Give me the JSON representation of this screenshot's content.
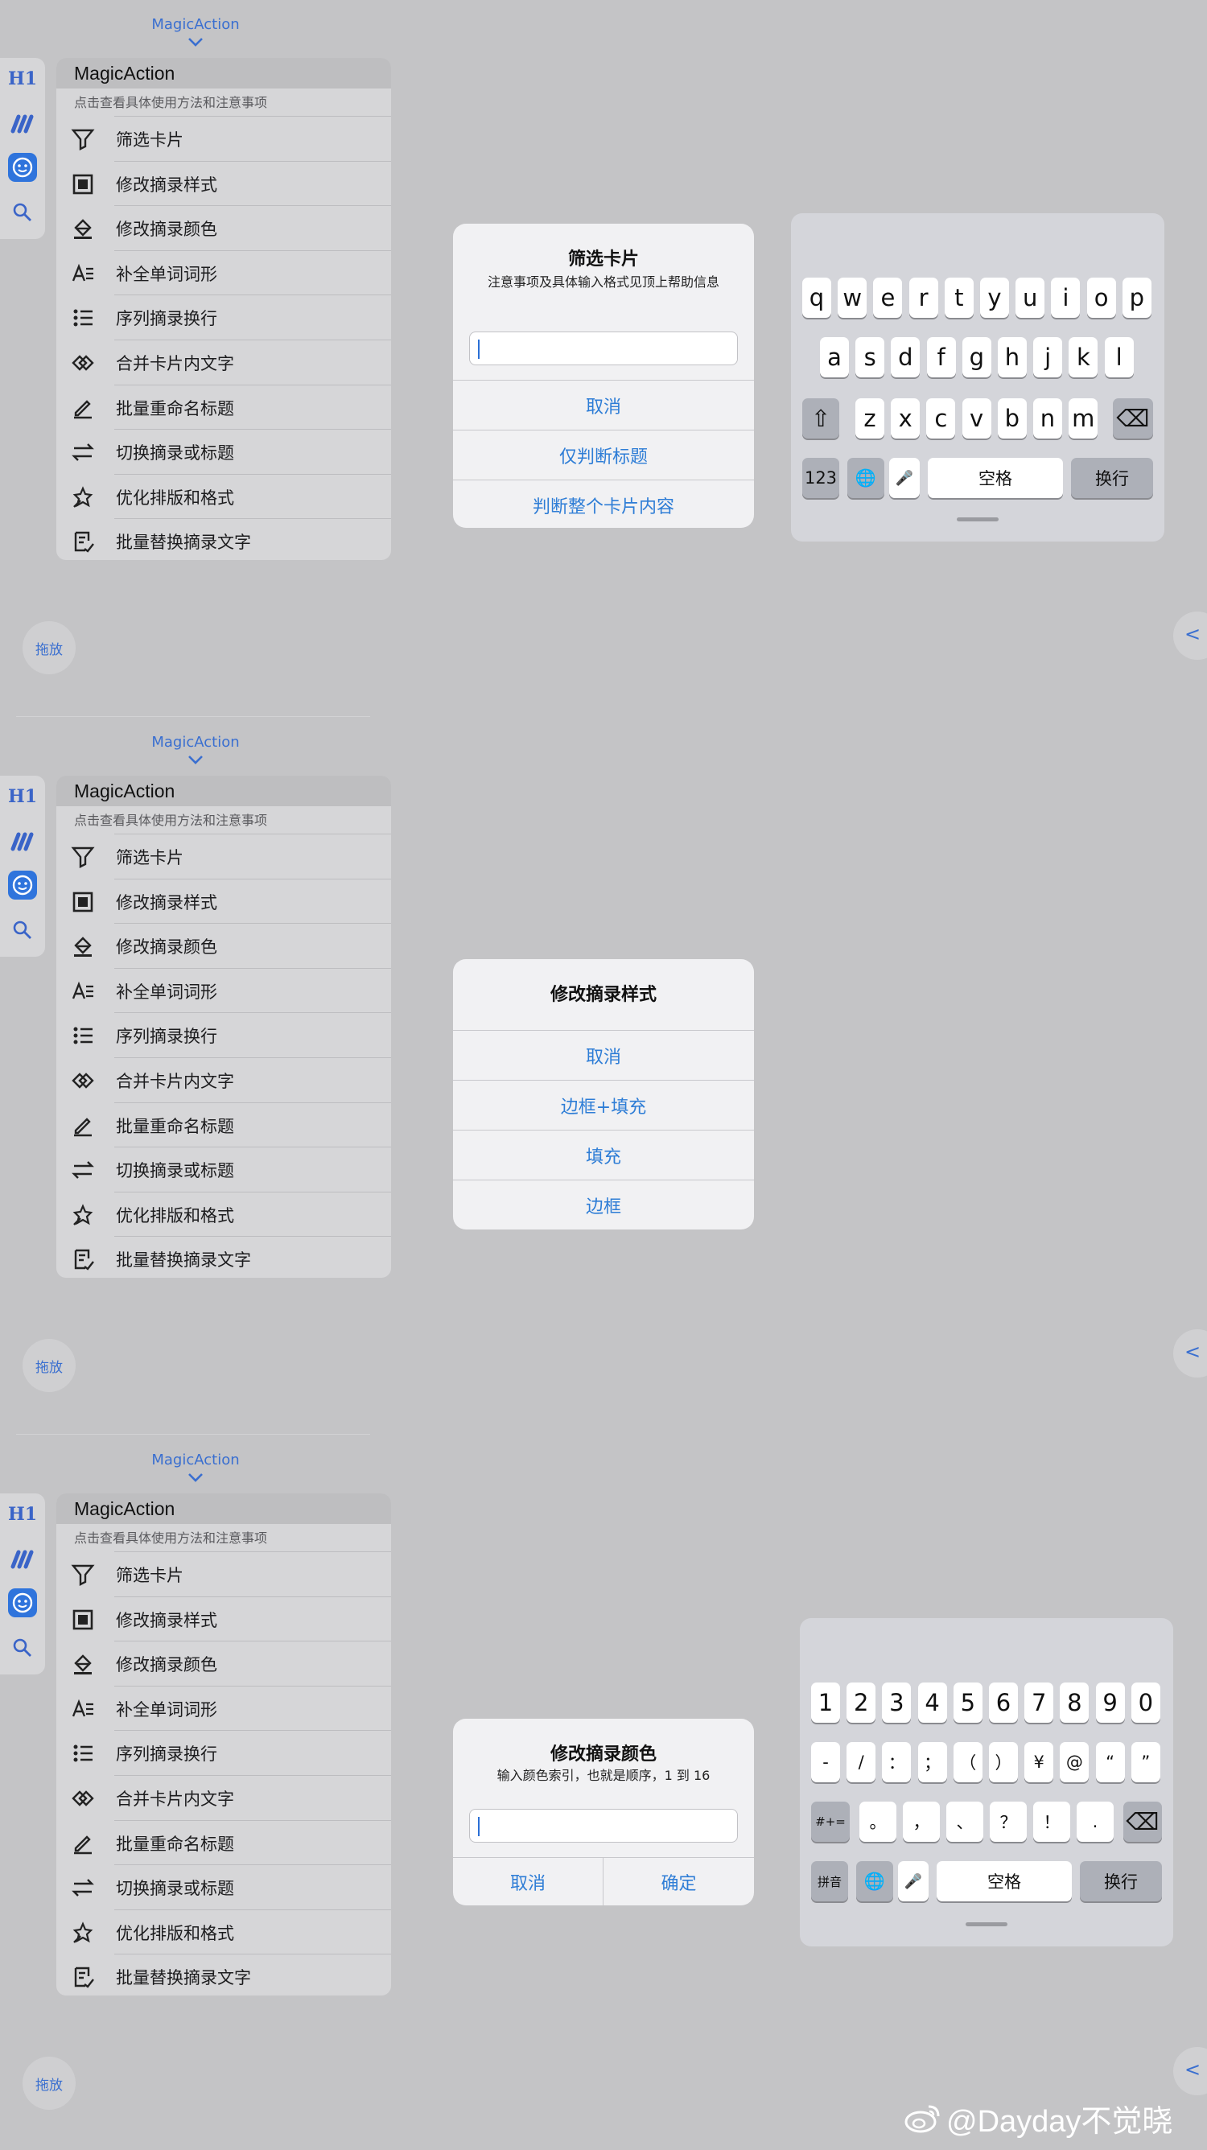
{
  "app_title": "MagicAction",
  "menu": {
    "title": "MagicAction",
    "subtitle": "点击查看具体使用方法和注意事项",
    "items": [
      {
        "label": "筛选卡片",
        "icon": "filter-icon"
      },
      {
        "label": "修改摘录样式",
        "icon": "style-icon"
      },
      {
        "label": "修改摘录颜色",
        "icon": "paint-bucket-icon"
      },
      {
        "label": "补全单词词形",
        "icon": "text-format-icon"
      },
      {
        "label": "序列摘录换行",
        "icon": "list-icon"
      },
      {
        "label": "合并卡片内文字",
        "icon": "merge-icon"
      },
      {
        "label": "批量重命名标题",
        "icon": "pencil-icon"
      },
      {
        "label": "切换摘录或标题",
        "icon": "swap-icon"
      },
      {
        "label": "优化排版和格式",
        "icon": "magic-icon"
      },
      {
        "label": "批量替换摘录文字",
        "icon": "replace-icon"
      }
    ]
  },
  "left_strip": {
    "h1": "H1",
    "icons": [
      "marginnote-icon",
      "face-icon",
      "search-icon"
    ]
  },
  "drag_label": "拖放",
  "edge_chevron": "<",
  "dialogs": {
    "filter": {
      "title": "筛选卡片",
      "message": "注意事项及具体输入格式见顶上帮助信息",
      "input_value": "",
      "buttons": [
        "取消",
        "仅判断标题",
        "判断整个卡片内容"
      ]
    },
    "style": {
      "title": "修改摘录样式",
      "buttons": [
        "取消",
        "边框+填充",
        "填充",
        "边框"
      ]
    },
    "color": {
      "title": "修改摘录颜色",
      "message": "输入颜色索引，也就是顺序，1 到 16",
      "input_value": "",
      "buttons": [
        "取消",
        "确定"
      ]
    }
  },
  "keyboard_letters": {
    "row1": [
      "q",
      "w",
      "e",
      "r",
      "t",
      "y",
      "u",
      "i",
      "o",
      "p"
    ],
    "row2": [
      "a",
      "s",
      "d",
      "f",
      "g",
      "h",
      "j",
      "k",
      "l"
    ],
    "row3": [
      "z",
      "x",
      "c",
      "v",
      "b",
      "n",
      "m"
    ],
    "shift": "⇧",
    "delete": "⌫",
    "numbers_key": "123",
    "globe": "🌐",
    "mic": "🎤",
    "space": "空格",
    "return": "换行"
  },
  "keyboard_numbers": {
    "row1": [
      "1",
      "2",
      "3",
      "4",
      "5",
      "6",
      "7",
      "8",
      "9",
      "0"
    ],
    "row2": [
      "-",
      "/",
      "：",
      "；",
      "（",
      "）",
      "¥",
      "@",
      "“",
      "”"
    ],
    "row3": [
      "。",
      "，",
      "、",
      "？",
      "！",
      "."
    ],
    "symbols_key": "#+=",
    "delete": "⌫",
    "pinyin_key": "拼音",
    "globe": "🌐",
    "mic": "🎤",
    "space": "空格",
    "return": "换行"
  },
  "watermark": "@Dayday不觉晓"
}
